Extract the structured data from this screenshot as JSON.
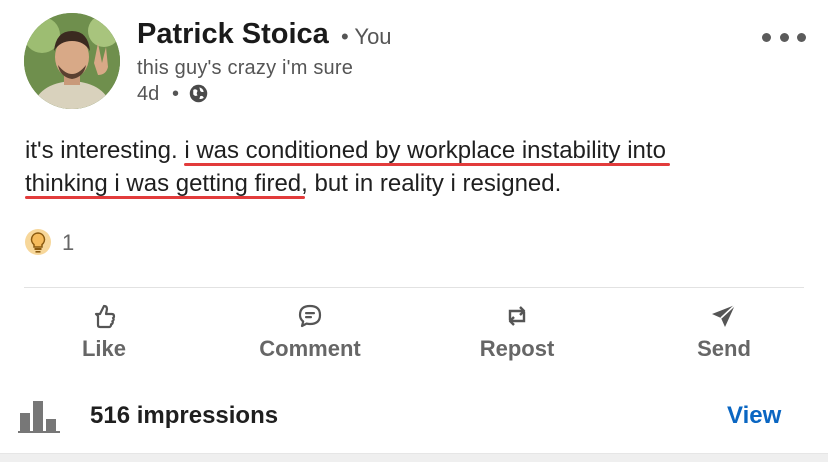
{
  "post": {
    "author": {
      "name": "Patrick Stoica",
      "badge": "• You",
      "headline": "this guy's crazy i'm sure",
      "age": "4d",
      "separator": "•",
      "visibility_icon": "globe-icon"
    },
    "menu_icon": "more-horizontal-icon",
    "body": {
      "part1": "it's interesting. ",
      "highlight1": "i was conditioned by workplace instability into",
      "highlight2": "thinking i was getting fired",
      "part2": ", but in reality i resigned."
    },
    "reactions": {
      "icon": "insightful-lightbulb-icon",
      "count": "1"
    },
    "actions": {
      "like": "Like",
      "comment": "Comment",
      "repost": "Repost",
      "send": "Send"
    },
    "analytics": {
      "icon": "bar-chart-icon",
      "impressions": "516 impressions",
      "view": "View"
    }
  },
  "colors": {
    "accent": "#0a66c2",
    "underline": "#e23b3b",
    "lightbulb": "#f5bb5c"
  }
}
